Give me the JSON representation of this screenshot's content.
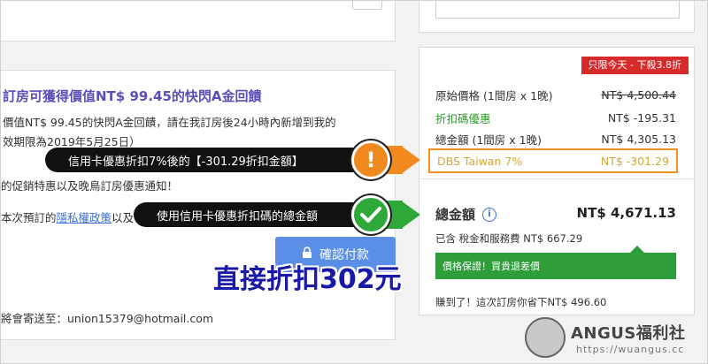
{
  "left_panel": {
    "promo_title": "訂房可獲得價值NT$ 99.45的快閃A金回饋",
    "promo_line1": "價值NT$ 99.45的快閃A金回饋，請在我訂房後24小時內新增到我的",
    "promo_line2": "效期限為2019年5月25日）",
    "notice_line1": "的促銷特惠以及晚鳥訂房優惠通知！",
    "notice_line2_prefix": "本次預訂的",
    "privacy_link": "隱私權政策",
    "notice_line2_suffix": "以及",
    "confirm_button": "確認付款",
    "email_line": "將會寄送至：union15379@hotmail.com"
  },
  "price_panel": {
    "badge": "只限今天 - 下殺3.8折",
    "rows": [
      {
        "label": "原始價格 (1間房 x 1晚)",
        "value": "NT$ 4,500.44"
      },
      {
        "label": "折扣碼優惠",
        "value": "NT$ -195.31"
      },
      {
        "label": "總金額 (1間房 x 1晚)",
        "value": "NT$ 4,305.13"
      }
    ],
    "dbs": {
      "label": "DBS Taiwan 7%",
      "value": "NT$ -301.29"
    },
    "total_label": "總金額",
    "total_value": "NT$ 4,671.13",
    "tax_line": "已含 稅金和服務費 NT$ 667.29",
    "guarantee": "價格保證！買貴退差價",
    "saved_line": "賺到了！這次訂房你省下NT$ 496.60"
  },
  "annotations": {
    "callout1": "信用卡優惠折扣7%後的【-301.29折扣金額】",
    "callout2": "使用信用卡優惠折扣碼的總金額",
    "headline": "直接折扣302元"
  },
  "watermark": {
    "title": "ANGUS福利社",
    "url": "https://wuangus.cc"
  },
  "colors": {
    "accent_orange": "#f08a1e",
    "accent_green": "#2fa83a",
    "promo_purple": "#5a4fb8",
    "badge_red": "#d72a2a",
    "button_blue": "#5b8ee6"
  }
}
